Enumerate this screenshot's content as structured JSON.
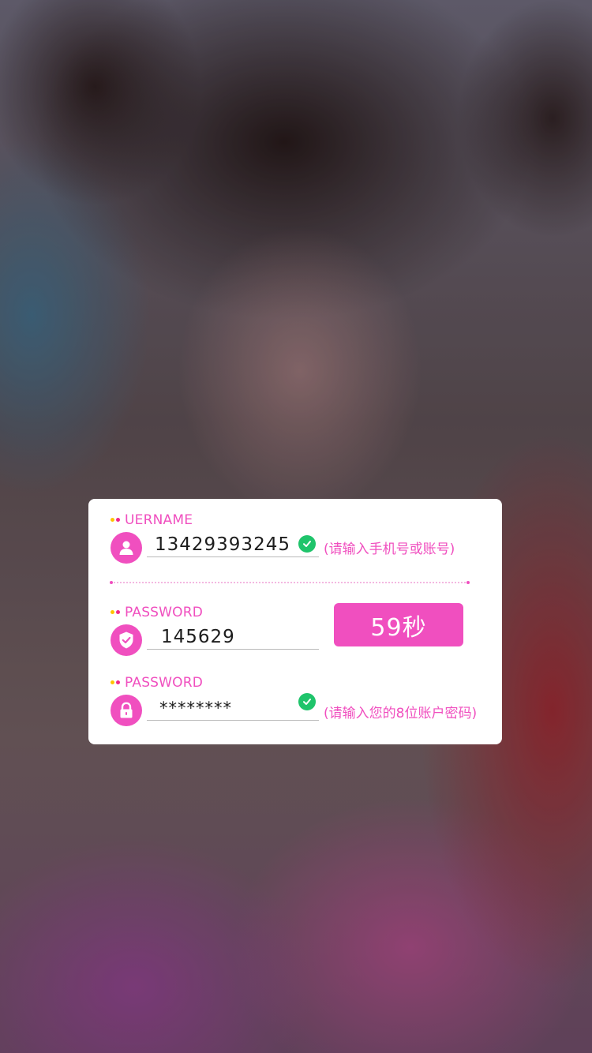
{
  "background": {
    "description_icon": "portrait-photo"
  },
  "colors": {
    "accent": "#f04fbf",
    "success": "#1fc46b",
    "dot_yellow": "#ffc400",
    "dot_pink": "#f0288c"
  },
  "login": {
    "username": {
      "label": "UERNAME",
      "value": "13429393245",
      "icon": "user-icon",
      "hint": "(请输入手机号或账号)"
    },
    "code": {
      "label": "PASSWORD",
      "value": "145629",
      "icon": "shield-check-icon",
      "timer": "59秒"
    },
    "password": {
      "label": "PASSWORD",
      "value": "********",
      "icon": "lock-icon",
      "hint": "(请输入您的8位账户密码)"
    }
  }
}
